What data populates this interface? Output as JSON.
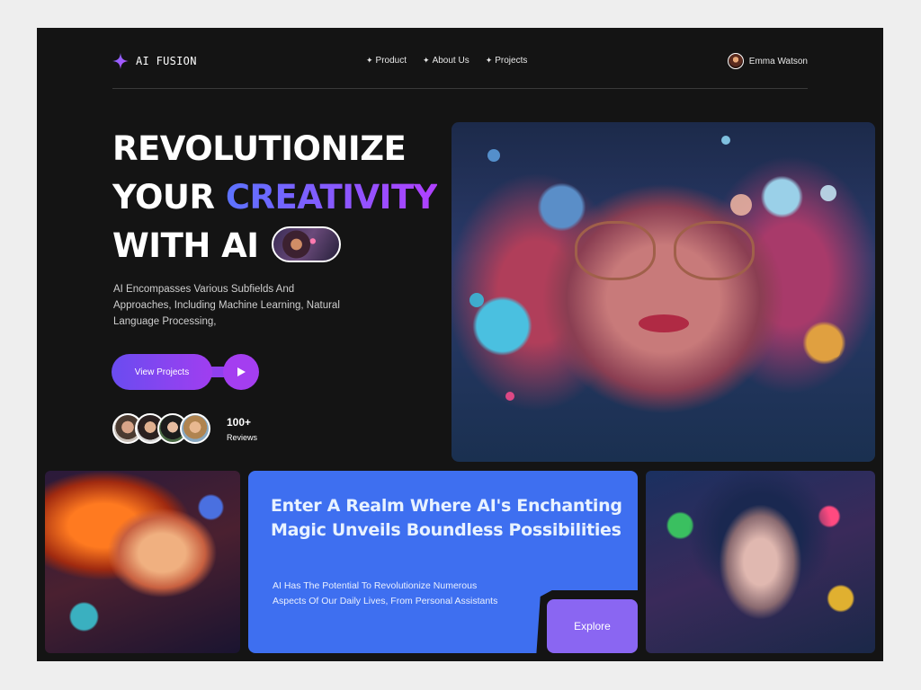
{
  "brand": {
    "name": "AI FUSION"
  },
  "nav": {
    "items": [
      {
        "label": "Product"
      },
      {
        "label": "About Us"
      },
      {
        "label": "Projects"
      }
    ]
  },
  "user": {
    "name": "Emma Watson"
  },
  "hero": {
    "line1": "REVOLUTIONIZE",
    "line2_plain": "YOUR",
    "line2_accent": "CREATIVITY",
    "line3": "WITH AI",
    "description": "AI Encompasses Various Subfields And Approaches, Including Machine Learning, Natural Language Processing,",
    "cta_label": "View Projects",
    "reviews_count": "100+",
    "reviews_label": "Reviews"
  },
  "feature": {
    "title": "Enter A Realm Where AI's Enchanting Magic Unveils Boundless Possibilities",
    "description": "AI Has The Potential To Revolutionize Numerous Aspects Of Our Daily Lives, From Personal Assistants",
    "button_label": "Explore"
  },
  "colors": {
    "background": "#141414",
    "accent_blue": "#3e6ff0",
    "accent_purple": "#a43ef0",
    "explore": "#8a66f2"
  }
}
